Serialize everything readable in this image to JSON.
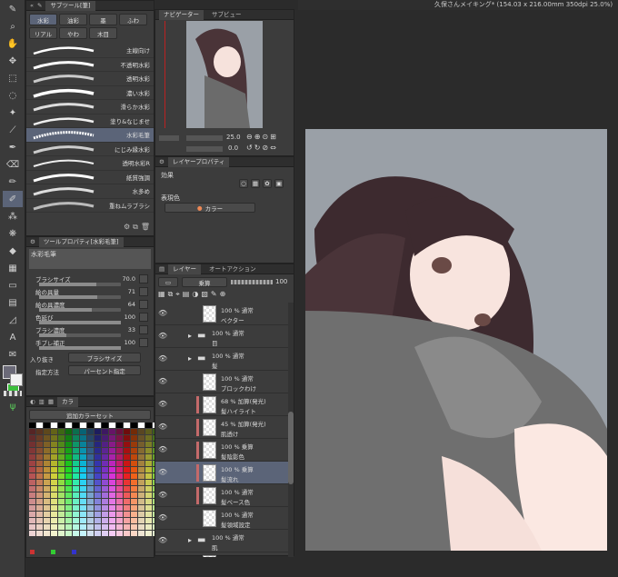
{
  "window_title": "久保さんメイキング* (154.03 x 216.00mm 350dpi 25.0%)",
  "subtool": {
    "tabs": [
      "サブツール[筆]"
    ],
    "groups": [
      "水彩",
      "油彩",
      "墨",
      "ふわ",
      "リアル",
      "やわ",
      "木目"
    ],
    "brushes": [
      "主線向け",
      "不透明水彩",
      "透明水彩",
      "濃い水彩",
      "滑らか水彩",
      "塗り&なじませ",
      "水彩毛筆",
      "にじみ縁水彩",
      "透明水彩R",
      "紙質強調",
      "水多め",
      "重ねムラブラシ"
    ],
    "selected_index": 6
  },
  "tool_property": {
    "title": "ツールプロパティ[水彩毛筆]",
    "preset": "水彩毛筆",
    "props": [
      {
        "label": "ブラシサイズ",
        "value": "70.0",
        "level": 0.7
      },
      {
        "label": "絵の具量",
        "value": "71",
        "level": 0.71
      },
      {
        "label": "絵の具濃度",
        "value": "64",
        "level": 0.64
      },
      {
        "label": "色延び",
        "value": "100",
        "level": 1.0
      },
      {
        "label": "ブラシ濃度",
        "value": "33",
        "level": 0.33
      },
      {
        "label": "手ブレ補正",
        "value": "100",
        "level": 1.0
      }
    ],
    "inout_label": "入り抜き",
    "inout_value": "ブラシサイズ",
    "method_label": "指定方法",
    "method_value": "パーセント指定"
  },
  "color_set": {
    "tab_label": "カラ",
    "set_name": "追加カラーセット"
  },
  "navigator": {
    "tabs": [
      "ナビゲーター",
      "サブビュー"
    ],
    "zoom": "25.0",
    "rotate": "0.0"
  },
  "layer_property": {
    "title": "レイヤープロパティ",
    "effect_label": "効果",
    "expression_label": "表現色",
    "expression_value": "カラー"
  },
  "layer_panel": {
    "tabs": [
      "レイヤー",
      "オートアクション"
    ],
    "blend_mode": "乗算",
    "opacity": "100",
    "layers": [
      {
        "line1": "100 % 通常",
        "line2": "ベクター",
        "type": "layer",
        "mark": false
      },
      {
        "line1": "100 % 通常",
        "line2": "目",
        "type": "folder",
        "mark": false
      },
      {
        "line1": "100 % 通常",
        "line2": "髪",
        "type": "folder",
        "mark": false
      },
      {
        "line1": "100 % 通常",
        "line2": "ブロックわけ",
        "type": "layer",
        "mark": false
      },
      {
        "line1": "68 % 加算(発光)",
        "line2": "髪ハイライト",
        "type": "layer",
        "mark": true
      },
      {
        "line1": "45 % 加算(発光)",
        "line2": "肌透け",
        "type": "layer",
        "mark": true
      },
      {
        "line1": "100 % 乗算",
        "line2": "髪陰影色",
        "type": "layer",
        "mark": true
      },
      {
        "line1": "100 % 乗算",
        "line2": "髪流れ",
        "type": "layer",
        "mark": true
      },
      {
        "line1": "100 % 通常",
        "line2": "髪ベース色",
        "type": "layer",
        "mark": true
      },
      {
        "line1": "100 % 通常",
        "line2": "髪領域設定",
        "type": "layer",
        "mark": false
      },
      {
        "line1": "100 % 通常",
        "line2": "肌",
        "type": "folder",
        "mark": false
      },
      {
        "line1": "58 % 通常",
        "line2": "",
        "type": "layer",
        "mark": false
      }
    ],
    "selected_index": 7
  },
  "colors": {
    "accent": "#5b6478",
    "canvas_bg": "#9aa0a7",
    "panel": "#3c3c3c"
  }
}
